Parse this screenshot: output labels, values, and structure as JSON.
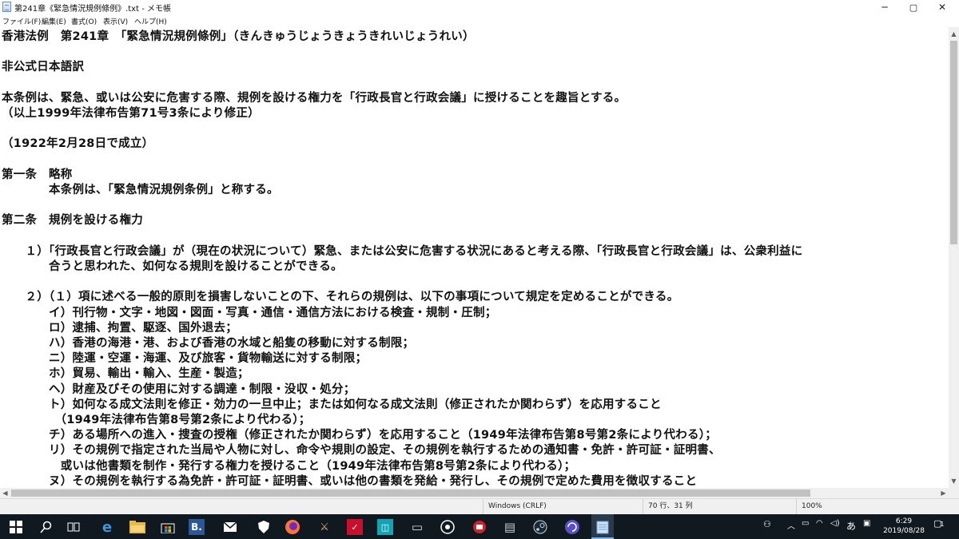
{
  "window": {
    "title": "第241章《緊急情況規例條例》.txt - メモ帳",
    "controls": {
      "minimize": "─",
      "maximize": "▢",
      "close": "✕"
    }
  },
  "menu": [
    "ファイル(F)",
    "編集(E)",
    "書式(O)",
    "表示(V)",
    "ヘルプ(H)"
  ],
  "document": {
    "lines": [
      "香港法例　第241章　「緊急情況規例條例」（きんきゅうじょうきょうきれいじょうれい）",
      "",
      "非公式日本語訳",
      "",
      "本条例は、緊急、或いは公安に危害する際、規例を設ける権力を「行政長官と行政会議」に授けることを趣旨とする。",
      "（以上1999年法律布告第71号3条により修正）",
      "",
      "（1922年2月28日で成立）",
      "",
      "第一条　略称",
      "　　　　本条例は、「緊急情況規例条例」と称する。",
      "",
      "第二条　規例を設ける権力",
      "",
      "　　１）「行政長官と行政会議」が（現在の状況について）緊急、または公安に危害する状況にあると考える際、「行政長官と行政会議」は、公衆利益に",
      "　　　　合うと思われた、如何なる規則を設けることができる。",
      "",
      "　　２）（１）項に述べる一般的原則を損害しないことの下、それらの規例は、以下の事項について規定を定めることができる。",
      "　　　　イ）刊行物・文字・地図・図面・写真・通信・通信方法における検査・規制・圧制；",
      "　　　　ロ）逮捕、拘置、駆逐、国外退去；",
      "　　　　ハ）香港の海港・港、および香港の水域と船隻の移動に対する制限；",
      "　　　　ニ）陸運・空運・海運、及び旅客・貨物輸送に対する制限；",
      "　　　　ホ）貿易、輸出・輸入、生産・製造；",
      "　　　　ヘ）財産及びその使用に対する調達・制限・没収・処分；",
      "　　　　ト）如何なる成文法則を修正・効力の一旦中止；または如何なる成文法則（修正されたか関わらず）を応用すること",
      "　　　　　（1949年法律布告第8号第2条により代わる）；",
      "　　　　チ）ある場所への進入・捜査の授権（修正されたか関わらず）を応用すること（1949年法律布告第8号第2条により代わる）；",
      "　　　　リ）その規例で指定された当局や人物に対し、命令や規則の設定、その規例を執行するための通知書・免許・許可証・証明書、",
      "　　　　　或いは他書類を制作・発行する権力を授けること（1949年法律布告第8号第2条により代わる）；",
      "　　　　ヌ）その規例を執行する為免許・許可証・証明書、或いは他の書類を発給・発行し、その規例で定めた費用を徴収すること"
    ]
  },
  "statusbar": {
    "encoding": "Windows (CRLF)",
    "position": "70 行、31 列",
    "zoom": "100%"
  },
  "taskbar": {
    "icons": [
      "windows-start",
      "search",
      "task-view",
      "edge",
      "file-explorer",
      "store",
      "app-b",
      "mail",
      "shield-app",
      "firefox",
      "game-app",
      "app-red",
      "app-teal",
      "app-camera",
      "app-disc",
      "app-red2",
      "app-cards",
      "steam",
      "app-swirl",
      "notepad"
    ],
    "tray_text": "あ",
    "clock_time": "6:29",
    "clock_date": "2019/08/28",
    "notification_count": "1"
  },
  "colors": {
    "taskbar_bg": "#101820",
    "scroll_thumb": "#c1c1c1",
    "accent": "#7fb2e5"
  }
}
